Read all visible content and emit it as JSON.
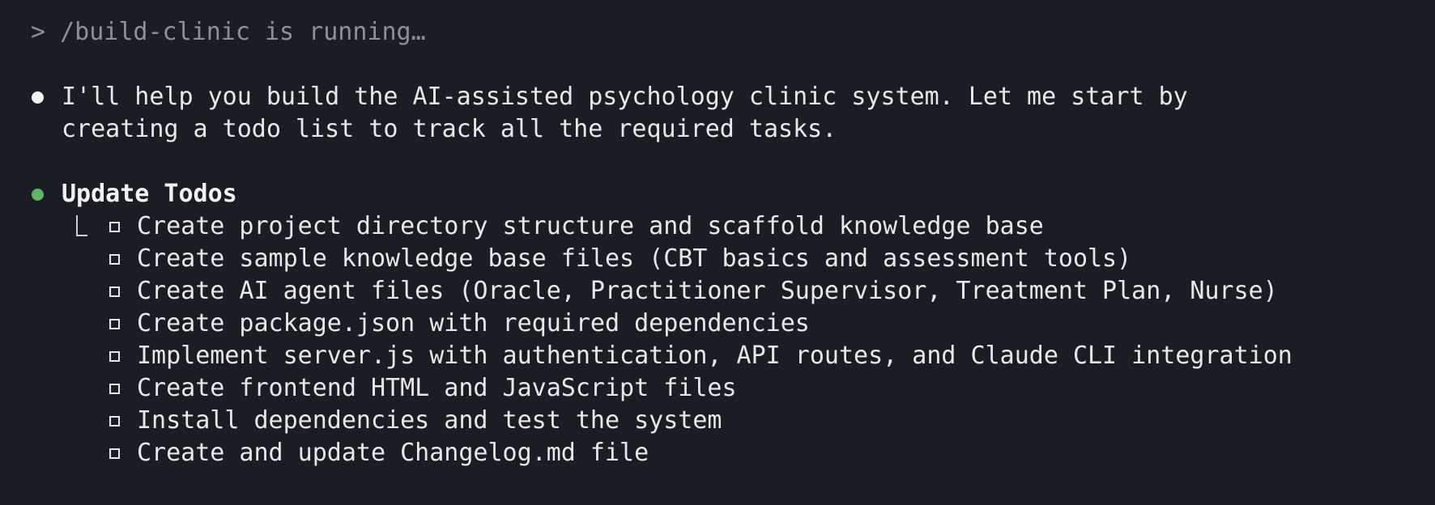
{
  "prompt": {
    "text": "> /build-clinic is running…"
  },
  "assistant_message": {
    "line1": "I'll help you build the AI-assisted psychology clinic system. Let me start by",
    "line2": "creating a todo list to track all the required tasks."
  },
  "todo_block": {
    "header": "Update Todos",
    "items": [
      {
        "label": "Create project directory structure and scaffold knowledge base"
      },
      {
        "label": "Create sample knowledge base files (CBT basics and assessment tools)"
      },
      {
        "label": "Create AI agent files (Oracle, Practitioner Supervisor, Treatment Plan, Nurse)"
      },
      {
        "label": "Create package.json with required dependencies"
      },
      {
        "label": "Implement server.js with authentication, API routes, and Claude CLI integration"
      },
      {
        "label": "Create frontend HTML and JavaScript files"
      },
      {
        "label": "Install dependencies and test the system"
      },
      {
        "label": "Create and update Changelog.md file"
      }
    ]
  },
  "colors": {
    "background": "#1b1d24",
    "text": "#e8e8ea",
    "muted": "#8f9096",
    "success_bullet": "#5fb36a"
  },
  "icons": {
    "message_bullet": "white-dot-icon",
    "tool_bullet": "green-dot-icon",
    "todo_marker": "empty-checkbox-icon",
    "tree_marker": "tree-branch-icon"
  }
}
